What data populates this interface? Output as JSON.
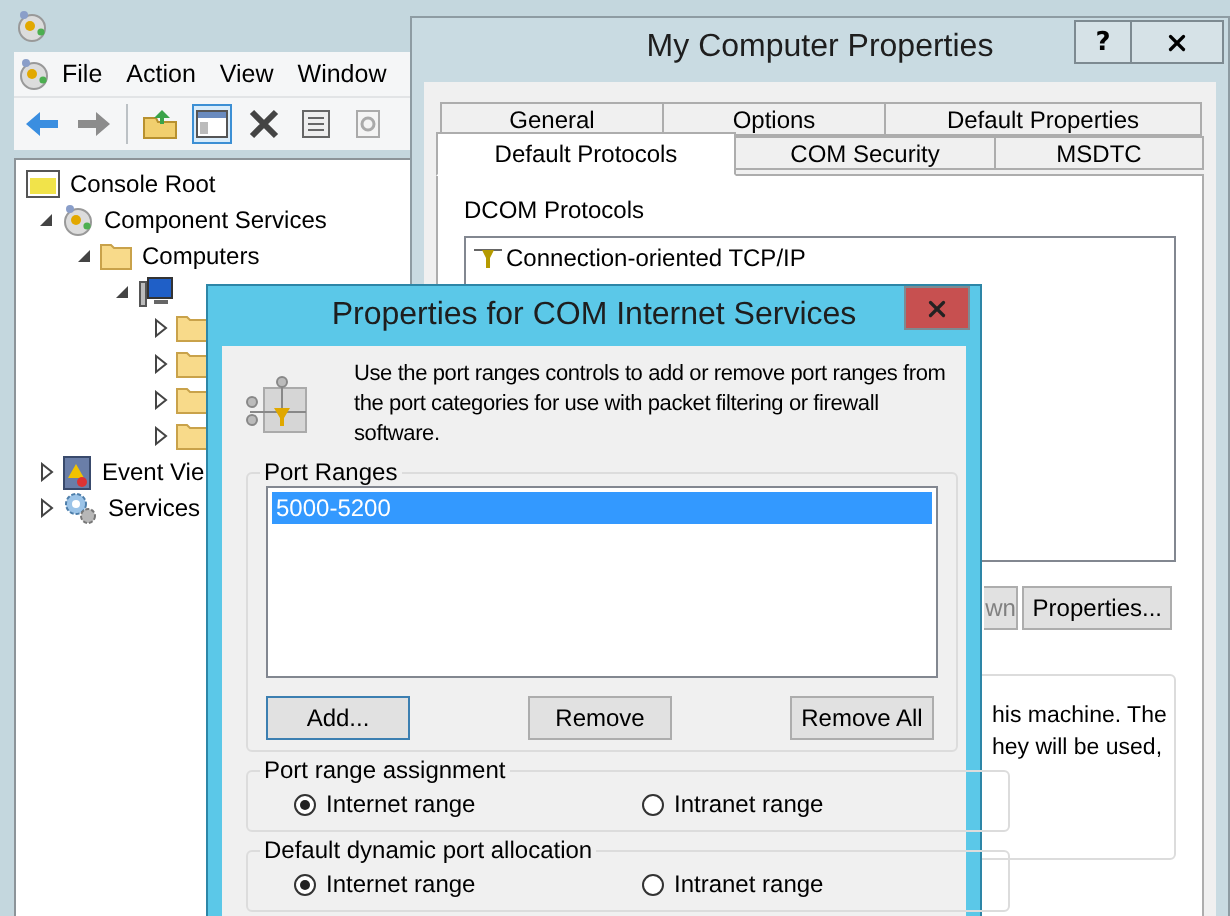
{
  "mmc": {
    "menu": [
      "File",
      "Action",
      "View",
      "Window"
    ],
    "tree": [
      {
        "label": "Console Root",
        "kind": "root",
        "selected": false,
        "children": [
          {
            "label": "Component Services",
            "kind": "component",
            "expanded": true,
            "selected": false,
            "children": [
              {
                "label": "Computers",
                "kind": "folder",
                "expanded": true,
                "selected": false,
                "children": [
                  {
                    "kind": "computer",
                    "expanded": true,
                    "children": [
                      {
                        "kind": "folder",
                        "expanded": false
                      },
                      {
                        "kind": "folder",
                        "expanded": false
                      },
                      {
                        "kind": "folder",
                        "expanded": false
                      },
                      {
                        "kind": "folder",
                        "expanded": false
                      }
                    ]
                  }
                ]
              }
            ]
          },
          {
            "label": "Event Vie",
            "kind": "event",
            "expanded": false,
            "selected": false
          },
          {
            "label": "Services",
            "kind": "services",
            "expanded": false,
            "selected": false
          }
        ]
      }
    ]
  },
  "properties": {
    "title": "My Computer Properties",
    "help": "?",
    "tab_rows": [
      [
        {
          "label": "General",
          "selected": false
        },
        {
          "label": "Options",
          "selected": false
        },
        {
          "label": "Default Properties",
          "selected": false
        }
      ],
      [
        {
          "label": "Default Protocols",
          "selected": true
        },
        {
          "label": "COM Security",
          "selected": false
        },
        {
          "label": "MSDTC",
          "selected": false
        }
      ]
    ],
    "protocols_label": "DCOM Protocols",
    "protocols": [
      {
        "label": "Connection-oriented TCP/IP",
        "selected": false
      }
    ],
    "buttons": [
      {
        "label": "wn",
        "disabled": true
      },
      {
        "label": "Properties...",
        "disabled": false
      }
    ],
    "note_lines": [
      "his machine. The",
      "hey will be used,"
    ]
  },
  "dialog": {
    "title": "Properties for COM Internet Services",
    "description": "Use the port ranges controls to add or remove port ranges from the port categories for use with packet filtering or firewall software.",
    "port_ranges": {
      "legend": "Port Ranges",
      "items": [
        {
          "label": "5000-5200",
          "selected": true
        }
      ],
      "buttons": [
        {
          "label": "Add...",
          "default": true
        },
        {
          "label": "Remove",
          "default": false
        },
        {
          "label": "Remove All",
          "default": false
        }
      ]
    },
    "groups": [
      {
        "legend": "Port range assignment",
        "options": [
          {
            "label": "Internet range",
            "selected": true
          },
          {
            "label": "Intranet range",
            "selected": false
          }
        ]
      },
      {
        "legend": "Default dynamic port allocation",
        "options": [
          {
            "label": "Internet range",
            "selected": true
          },
          {
            "label": "Intranet range",
            "selected": false
          }
        ]
      }
    ]
  }
}
